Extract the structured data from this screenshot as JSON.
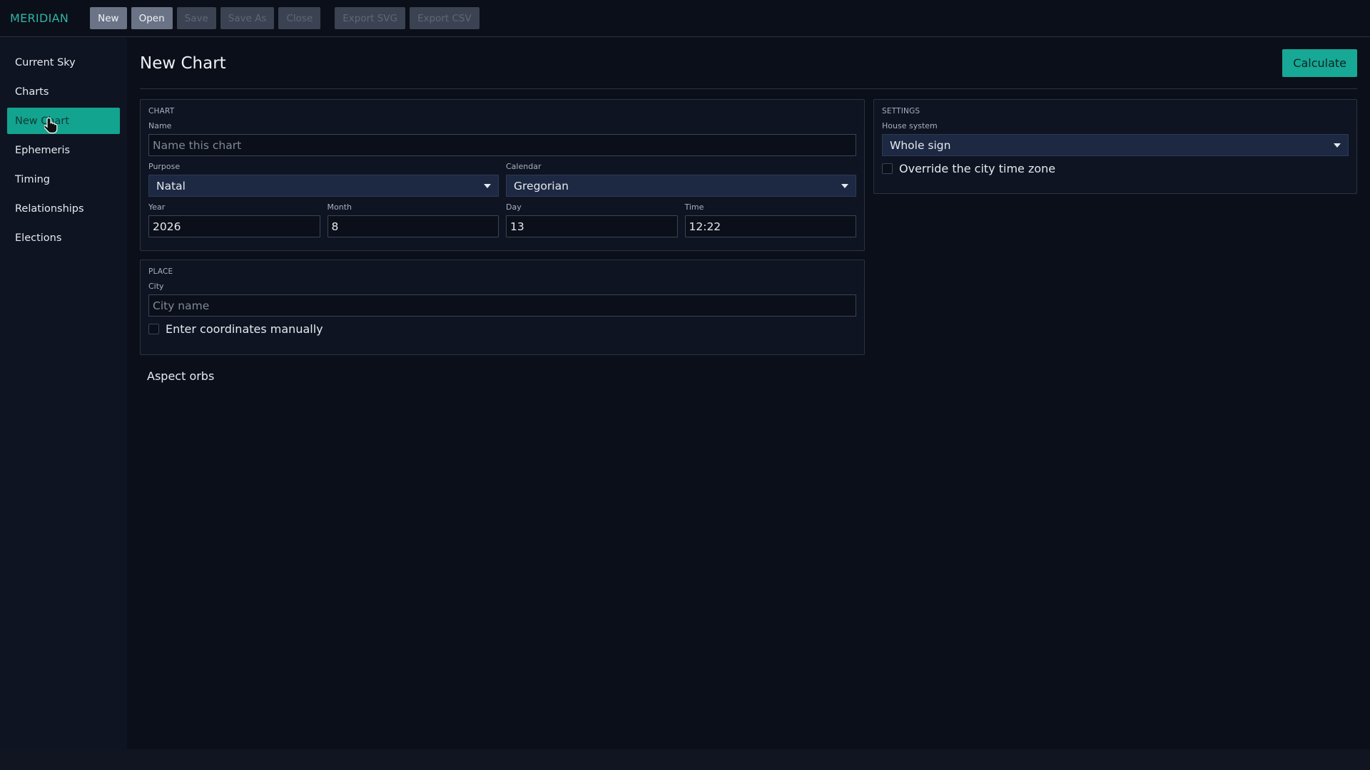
{
  "app": {
    "brand": "MERIDIAN"
  },
  "toolbar": {
    "buttons": [
      {
        "label": "New",
        "enabled": true
      },
      {
        "label": "Open",
        "enabled": true
      },
      {
        "label": "Save",
        "enabled": false
      },
      {
        "label": "Save As",
        "enabled": false
      },
      {
        "label": "Close",
        "enabled": false
      },
      {
        "label": "Export SVG",
        "enabled": false
      },
      {
        "label": "Export CSV",
        "enabled": false
      }
    ]
  },
  "sidebar": {
    "items": [
      {
        "label": "Current Sky",
        "active": false
      },
      {
        "label": "Charts",
        "active": false
      },
      {
        "label": "New Chart",
        "active": true
      },
      {
        "label": "Ephemeris",
        "active": false
      },
      {
        "label": "Timing",
        "active": false
      },
      {
        "label": "Relationships",
        "active": false
      },
      {
        "label": "Elections",
        "active": false
      }
    ]
  },
  "page": {
    "title": "New Chart",
    "calculate_label": "Calculate"
  },
  "chart_card": {
    "title": "CHART",
    "name_label": "Name",
    "name_placeholder": "Name this chart",
    "name_value": "",
    "purpose_label": "Purpose",
    "purpose_value": "Natal",
    "calendar_label": "Calendar",
    "calendar_value": "Gregorian",
    "year_label": "Year",
    "year_value": "2026",
    "month_label": "Month",
    "month_value": "8",
    "day_label": "Day",
    "day_value": "13",
    "time_label": "Time",
    "time_value": "12:22"
  },
  "place_card": {
    "title": "PLACE",
    "city_label": "City",
    "city_placeholder": "City name",
    "manual_coords_label": "Enter coordinates manually",
    "manual_coords_checked": false
  },
  "settings_card": {
    "title": "SETTINGS",
    "house_system_label": "House system",
    "house_system_value": "Whole sign",
    "override_tz_label": "Override the city time zone",
    "override_tz_checked": false
  },
  "aspect_orbs": {
    "label": "Aspect orbs"
  },
  "colors": {
    "accent": "#17a896",
    "background": "#0b0f19",
    "panel": "#0f1422",
    "select_bg": "#1d2942"
  }
}
